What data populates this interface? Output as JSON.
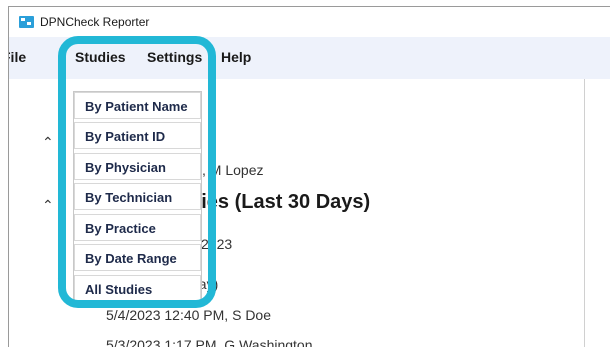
{
  "window": {
    "title": "DPNCheck Reporter"
  },
  "menubar": {
    "items": [
      "File",
      "Studies",
      "Settings",
      "Help"
    ]
  },
  "content": {
    "recent_entry": "AM, M Lopez",
    "section_heading": "dies (Last 30 Days)",
    "date_partial": "2023",
    "day_partial": "day)",
    "entries": [
      "5/4/2023 12:40 PM, S Doe",
      "5/3/2023 1:17 PM, G Washington"
    ]
  },
  "studies_menu": {
    "items": [
      "By Patient Name",
      "By Patient ID",
      "By Physician",
      "By Technician",
      "By Practice",
      "By Date Range",
      "All Studies"
    ]
  },
  "colors": {
    "menubar_bg": "#eef2fb",
    "highlight": "#22b8d6",
    "menu_text": "#1e2a4a"
  }
}
